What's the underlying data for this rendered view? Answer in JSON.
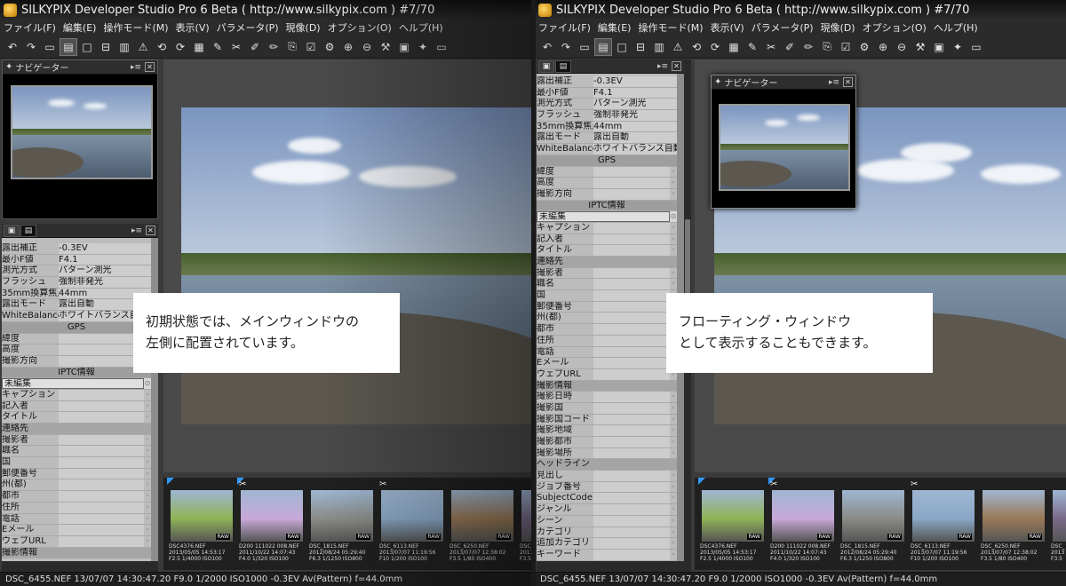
{
  "window_title": "SILKYPIX Developer Studio Pro 6 Beta ( http://www.silkypix.com )  #7/70",
  "menu": [
    "ファイル(F)",
    "編集(E)",
    "操作モード(M)",
    "表示(V)",
    "パラメータ(P)",
    "現像(D)",
    "オプション(O)",
    "ヘルプ(H)"
  ],
  "toolbar_icons": [
    "undo-icon",
    "redo-icon",
    "view-single-icon",
    "view-grid-icon",
    "view-full-icon",
    "view-compare-icon",
    "view-list-icon",
    "warning-icon",
    "rotate-left-icon",
    "rotate-right-icon",
    "adjust-icon",
    "magic-icon",
    "crop-icon",
    "eyedropper-icon",
    "brush-icon",
    "stamp-icon",
    "check-icon",
    "settings-icon",
    "copy-icon",
    "paste-icon",
    "tool-icon",
    "folder-icon",
    "batch-icon",
    "monitor-icon"
  ],
  "toolbar_glyphs": [
    "↶",
    "↷",
    "▭",
    "▤",
    "□",
    "⊟",
    "▥",
    "⚠",
    "⟲",
    "⟳",
    "▦",
    "✎",
    "✂",
    "✐",
    "✏",
    "⎘",
    "☑",
    "⚙",
    "⊕",
    "⊖",
    "⚒",
    "▣",
    "✦",
    "▭"
  ],
  "navigator": {
    "title": "ナビゲーター",
    "pin": "▸≡",
    "close": "✕"
  },
  "info_rows_left": [
    {
      "k": "露出補正",
      "v": "-0.3EV"
    },
    {
      "k": "最小F値",
      "v": "F4.1"
    },
    {
      "k": "測光方式",
      "v": "パターン測光"
    },
    {
      "k": "フラッシュ",
      "v": "強制非発光"
    },
    {
      "k": "35mm換算焦点",
      "v": "44mm"
    },
    {
      "k": "露出モード",
      "v": "露出自動"
    },
    {
      "k": "WhiteBalance",
      "v": "ホワイトバランス自動"
    }
  ],
  "info_rows_right": [
    {
      "k": "露出補正",
      "v": "-0.3EV"
    },
    {
      "k": "最小F値",
      "v": "F4.1"
    },
    {
      "k": "測光方式",
      "v": "パターン測光"
    },
    {
      "k": "フラッシュ",
      "v": "強制非発光"
    },
    {
      "k": "35mm換算焦点",
      "v": "44mm"
    },
    {
      "k": "露出モード",
      "v": "露出自動"
    },
    {
      "k": "WhiteBalance",
      "v": "ホワイトバランス自動"
    }
  ],
  "gps_title": "GPS",
  "gps_rows": [
    "緯度",
    "高度",
    "撮影方向"
  ],
  "iptc_title": "IPTC情報",
  "iptc_select": "未編集",
  "iptc_rows_left": [
    "キャプション",
    "記入者",
    "タイトル",
    "#連絡先",
    "撮影者",
    "職名",
    "国",
    "郵便番号",
    "州(都)",
    "都市",
    "住所",
    "電話",
    "Eメール",
    "ウェブURL",
    "#撮影情報"
  ],
  "iptc_rows_right": [
    "キャプション",
    "記入者",
    "タイトル",
    "#連絡先",
    "撮影者",
    "職名",
    "国",
    "郵便番号",
    "州(都)",
    "都市",
    "住所",
    "電話",
    "Eメール",
    "ウェブURL",
    "#撮影情報",
    "撮影日時",
    "撮影国",
    "撮影国コード",
    "撮影地域",
    "撮影都市",
    "撮影場所",
    "#ヘッドライン",
    "見出し",
    "ジョブ番号",
    "SubjectCode",
    "ジャンル",
    "シーン",
    "カテゴリ",
    "追加カテゴリ",
    "キーワード"
  ],
  "captions": {
    "left": "初期状態では、メインウィンドウの\n左側に配置されています。",
    "right": "フローティング・ウィンドウ\nとして表示することもできます。"
  },
  "thumbnails": [
    {
      "name": "DSC4376.NEF",
      "info": "2013/05/05 14:53:17\nF2.5 1/4000 ISO100",
      "raw": "RAW",
      "cut": false,
      "color": "#8fb356"
    },
    {
      "name": "D200 111022 008.NEF",
      "info": "2011/10/22 14:07:43\nF4.0 1/320 ISO100",
      "raw": "RAW",
      "cut": true,
      "color": "#c9a9d9"
    },
    {
      "name": "DSC_1815.NEF",
      "info": "2012/08/24 05:29:40\nF6.3 1/1250 ISO800",
      "raw": "RAW",
      "cut": false,
      "color": "#8a8c86"
    },
    {
      "name": "DSC_6113.NEF",
      "info": "2013/07/07 11:19:56\nF10 1/200 ISO100",
      "raw": "RAW",
      "cut": true,
      "color": "#8aa9c7"
    },
    {
      "name": "DSC_6250.NEF",
      "info": "2013/07/07 12:38:02\nF3.5 1/80 ISO400",
      "raw": "RAW",
      "cut": false,
      "color": "#9a7a56"
    },
    {
      "name": "DSC_",
      "info": "2013\nF3.5",
      "raw": "",
      "cut": false,
      "color": "#7a6a8a"
    }
  ],
  "status": "DSC_6455.NEF 13/07/07 14:30:47.20 F9.0  1/2000  ISO1000 -0.3EV Av(Pattern) f=44.0mm"
}
